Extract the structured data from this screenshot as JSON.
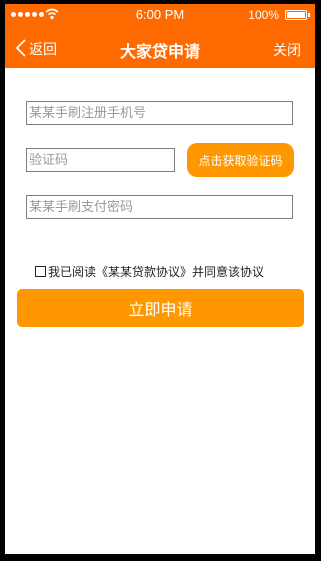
{
  "status_bar": {
    "time": "6:00 PM",
    "battery_percent": "100%",
    "battery_level": 1.0
  },
  "nav": {
    "back_label": "返回",
    "title": "大家贷申请",
    "close_label": "关闭"
  },
  "form": {
    "phone_placeholder": "某某手刷注册手机号",
    "code_placeholder": "验证码",
    "get_code_label": "点击获取验证码",
    "password_placeholder": "某某手刷支付密码",
    "agreement_prefix": "我已阅读",
    "agreement_link": "《某某贷款协议》",
    "agreement_suffix": "并同意该协议",
    "agreement_checked": false,
    "submit_label": "立即申请"
  },
  "colors": {
    "header_bg": "#ff6a00",
    "button_bg": "#ff9800",
    "frame_bg": "#000000"
  },
  "icons": {
    "back": "chevron-left-icon",
    "signal": "signal-dots-icon",
    "wifi": "wifi-icon",
    "battery": "battery-icon"
  }
}
